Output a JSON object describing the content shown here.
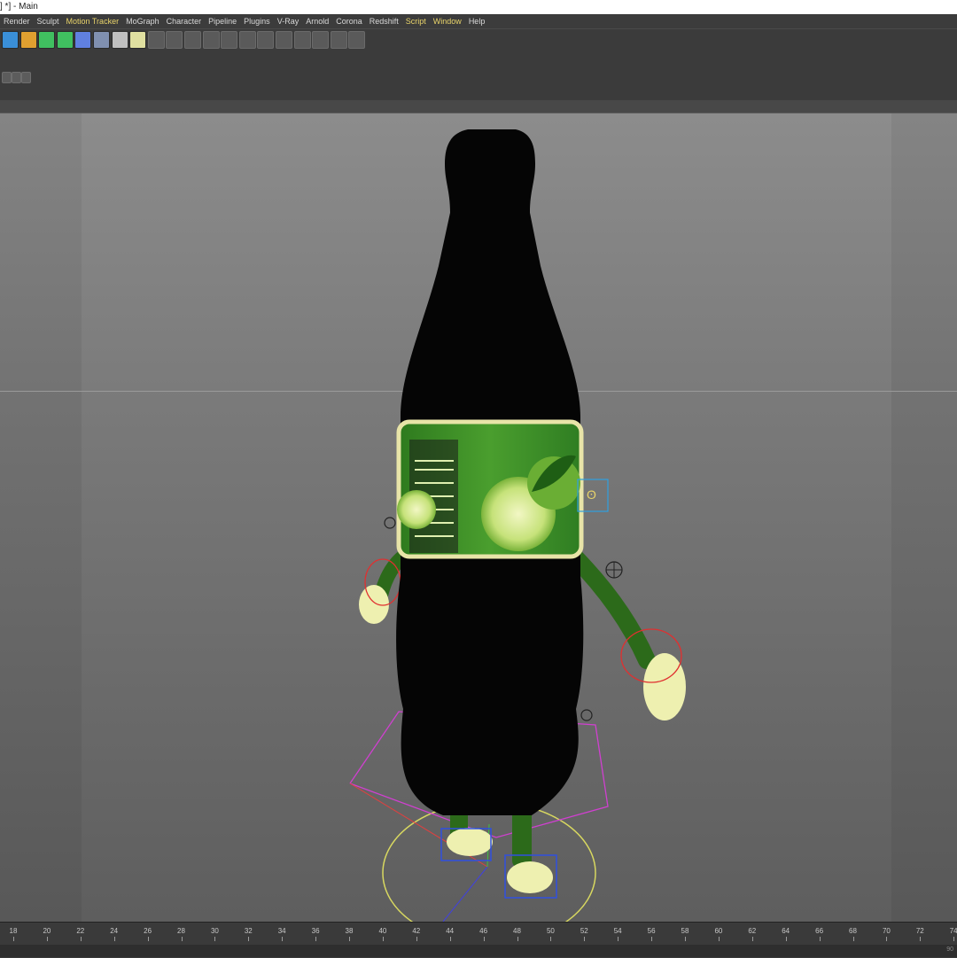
{
  "window": {
    "title": "] *] - Main"
  },
  "menu": {
    "items": [
      "Render",
      "Sculpt",
      "Motion Tracker",
      "MoGraph",
      "Character",
      "Pipeline",
      "Plugins",
      "V-Ray",
      "Arnold",
      "Corona",
      "Redshift",
      "Script",
      "Window",
      "Help"
    ],
    "highlighted": [
      "Motion Tracker",
      "Script",
      "Window"
    ]
  },
  "toolbar": {
    "icons": [
      "cube-icon",
      "pen-icon",
      "subdivide-icon",
      "array-icon",
      "deformer-icon",
      "floor-icon",
      "camera-icon",
      "light-icon",
      "tool-icon",
      "tool-icon",
      "tool-icon",
      "tool-icon",
      "tool-icon",
      "tool-icon",
      "tool-icon",
      "tool-icon",
      "tool-icon",
      "tool-icon",
      "tool-icon",
      "tool-icon"
    ]
  },
  "timeline": {
    "labels": [
      "18",
      "20",
      "22",
      "24",
      "26",
      "28",
      "30",
      "32",
      "34",
      "36",
      "38",
      "40",
      "42",
      "44",
      "46",
      "48",
      "50",
      "52",
      "54",
      "56",
      "58",
      "60",
      "62",
      "64",
      "66",
      "68",
      "70",
      "72",
      "74"
    ],
    "end_label": "90"
  },
  "colors": {
    "menu_highlight": "#e8d36a",
    "bottle": "#050505",
    "label_green": "#3f8f2a",
    "selection_red": "#e03030",
    "rig_magenta": "#d040d0",
    "rig_blue": "#3050e0",
    "ground_circle": "#d8d860"
  }
}
